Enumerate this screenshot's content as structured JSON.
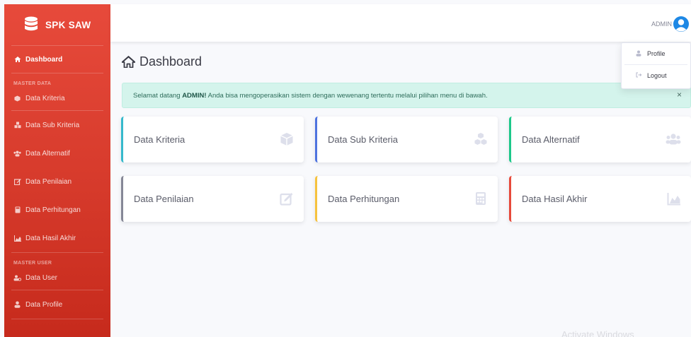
{
  "brand": {
    "name": "SPK SAW"
  },
  "sidebar": {
    "active": {
      "label": "Dashboard",
      "icon": "home-icon"
    },
    "heading_master_data": "MASTER DATA",
    "items": [
      {
        "label": "Data Kriteria",
        "icon": "cube-icon"
      },
      {
        "label": "Data Sub Kriteria",
        "icon": "cubes-icon"
      },
      {
        "label": "Data Alternatif",
        "icon": "users-icon"
      },
      {
        "label": "Data Penilaian",
        "icon": "edit-icon"
      },
      {
        "label": "Data Perhitungan",
        "icon": "calculator-icon"
      },
      {
        "label": "Data Hasil Akhir",
        "icon": "chart-area-icon"
      }
    ],
    "heading_master_user": "MASTER USER",
    "user_items": [
      {
        "label": "Data User",
        "icon": "users-cog-icon"
      },
      {
        "label": "Data Profile",
        "icon": "user-icon"
      }
    ]
  },
  "topbar": {
    "user_name": "ADMIN"
  },
  "dropdown": {
    "profile": "Profile",
    "logout": "Logout"
  },
  "page": {
    "title": "Dashboard"
  },
  "alert": {
    "prefix": "Selamat datang ",
    "bold": "ADMIN!",
    "suffix": " Anda bisa mengoperasikan sistem dengan wewenang tertentu melalui pilihan menu di bawah.",
    "close": "×"
  },
  "cards": [
    {
      "label": "Data Kriteria",
      "icon": "cube-icon",
      "accent": "#36b9cc"
    },
    {
      "label": "Data Sub Kriteria",
      "icon": "cubes-icon",
      "accent": "#4e73df"
    },
    {
      "label": "Data Alternatif",
      "icon": "users-icon",
      "accent": "#1cc88a"
    },
    {
      "label": "Data Penilaian",
      "icon": "edit-icon",
      "accent": "#858796"
    },
    {
      "label": "Data Perhitungan",
      "icon": "calculator-icon",
      "accent": "#f6c23e"
    },
    {
      "label": "Data Hasil Akhir",
      "icon": "chart-area-icon",
      "accent": "#e74a3b"
    }
  ],
  "watermark": "Activate Windows",
  "colors": {
    "sidebar": "#e74a3b",
    "alert_bg": "#d4f4ec",
    "avatar": "#1e88e5"
  }
}
